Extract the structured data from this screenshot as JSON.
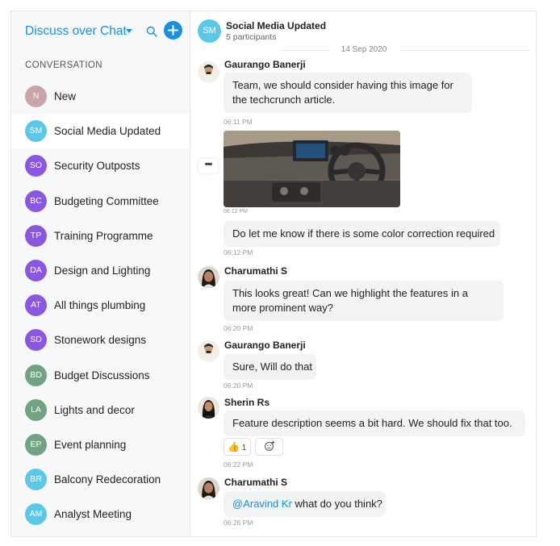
{
  "sidebar": {
    "app_title": "Discuss over Chat",
    "section_label": "CONVERSATION",
    "items": [
      {
        "initials": "N",
        "name": "New",
        "color": "#c9a4a8"
      },
      {
        "initials": "SM",
        "name": "Social Media Updated",
        "color": "#5bc8e8"
      },
      {
        "initials": "SO",
        "name": "Security Outposts",
        "color": "#8a57e0"
      },
      {
        "initials": "BC",
        "name": "Budgeting Committee",
        "color": "#8a57e0"
      },
      {
        "initials": "TP",
        "name": "Training Programme",
        "color": "#8a57e0"
      },
      {
        "initials": "DA",
        "name": "Design and Lighting",
        "color": "#8a57e0"
      },
      {
        "initials": "AT",
        "name": "All things plumbing",
        "color": "#8a57e0"
      },
      {
        "initials": "SD",
        "name": "Stonework designs",
        "color": "#8a57e0"
      },
      {
        "initials": "BD",
        "name": "Budget Discussions",
        "color": "#6fa382"
      },
      {
        "initials": "LA",
        "name": "Lights and decor",
        "color": "#6fa382"
      },
      {
        "initials": "EP",
        "name": "Event planning",
        "color": "#6fa382"
      },
      {
        "initials": "BR",
        "name": "Balcony Redecoration",
        "color": "#5bc8e8"
      },
      {
        "initials": "AM",
        "name": "Analyst Meeting",
        "color": "#5bc8e8"
      }
    ],
    "active_index": 1
  },
  "chat": {
    "avatar_initials": "SM",
    "title": "Social Media Updated",
    "participants": "5 participants",
    "date": "14 Sep 2020"
  },
  "messages": {
    "m1_sender": "Gaurango Banerji",
    "m1_text": "Team, we should consider having this image for the techcrunch article.",
    "m1_time": "06:11 PM",
    "m2_time": "06:12 PM",
    "m3_text": "Do let me know if there is some color correction required",
    "m3_time": "06:12 PM",
    "m4_sender": "Charumathi S",
    "m4_text": "This looks great! Can we highlight the features in a more prominent way?",
    "m4_time": "06:20 PM",
    "m5_sender": "Gaurango Banerji",
    "m5_text": "Sure, Will do that",
    "m5_time": "06:20 PM",
    "m6_sender": "Sherin Rs",
    "m6_text": "Feature description seems a bit hard. We should fix that too.",
    "m6_reaction_count": "1",
    "m6_time": "06:22 PM",
    "m7_sender": "Charumathi S",
    "m7_mention": "@Aravind Kr",
    "m7_text": " what do you think?",
    "m7_time": "06:26 PM"
  },
  "colors": {
    "accent": "#1a8fdd",
    "bubble": "#f2f3f5",
    "sidebar_bg": "#f7f8fa"
  },
  "icons": {
    "search": "search-icon",
    "add": "plus-icon",
    "more": "more-options-icon",
    "thumbs": "thumbs-up-icon",
    "add_reaction": "add-reaction-icon"
  }
}
